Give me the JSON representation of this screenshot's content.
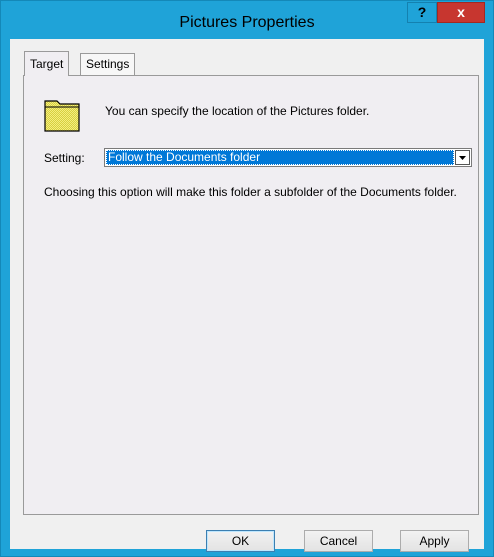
{
  "window": {
    "title": "Pictures Properties",
    "help_label": "?",
    "close_label": "x"
  },
  "tabs": [
    {
      "label": "Target",
      "selected": true
    },
    {
      "label": "Settings",
      "selected": false
    }
  ],
  "target": {
    "folder_icon": "folder-icon",
    "info_text": "You can specify the location of the Pictures folder.",
    "setting_label": "Setting:",
    "setting_value": "Follow the Documents folder",
    "description": "Choosing this option will make this folder a subfolder of the Documents folder."
  },
  "buttons": {
    "ok": "OK",
    "cancel": "Cancel",
    "apply": "Apply"
  },
  "colors": {
    "title_bar": "#1fa3d8",
    "close_button": "#c7362f",
    "selection": "#0078d7"
  }
}
